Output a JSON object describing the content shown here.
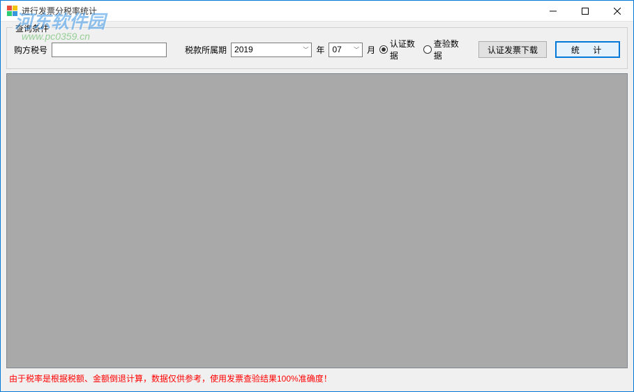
{
  "window": {
    "title": "进行发票分税率统计"
  },
  "groupbox": {
    "title": "查询条件"
  },
  "query": {
    "buyer_tax_label": "购方税号",
    "buyer_tax_value": "",
    "tax_period_label": "税款所属期",
    "year_value": "2019",
    "year_suffix": "年",
    "month_value": "07",
    "month_suffix": "月",
    "radio_auth": "认证数据",
    "radio_verify": "查验数据",
    "radio_selected": "auth",
    "download_button": "认证发票下载",
    "stats_button": "统 计"
  },
  "footer": {
    "warning": "由于税率是根据税额、金额倒退计算，数据仅供参考，使用发票查验结果100%准确度！"
  },
  "watermark": {
    "main": "河东软件园",
    "sub": "www.pc0359.cn"
  }
}
